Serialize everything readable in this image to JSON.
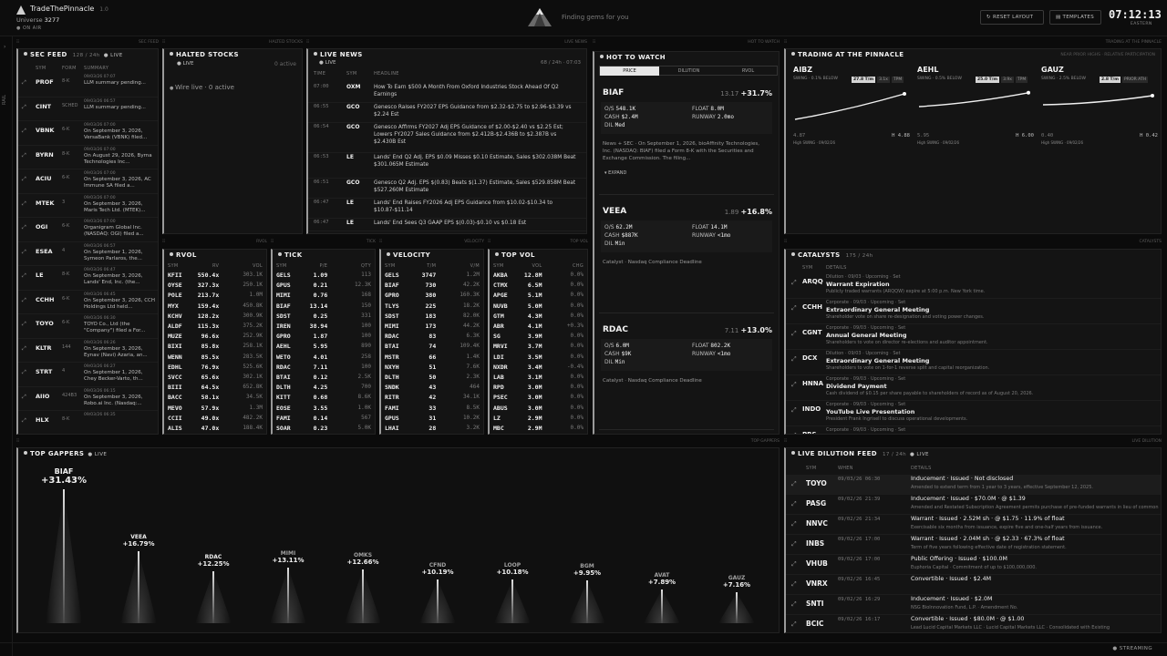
{
  "app": {
    "name": "TradeThePinnacle",
    "version": "1.0",
    "universe_label": "Universe",
    "universe_count": "3277",
    "onair": "ON AIR",
    "tagline": "Finding gems for you",
    "rail": "RAIL"
  },
  "toolbar": {
    "reset_label": "RESET LAYOUT",
    "templates_label": "TEMPLATES",
    "clock": "07:12:13",
    "timezone": "EASTERN"
  },
  "sec_feed": {
    "title": "SEC FEED",
    "count": "128 / 24h",
    "live": "LIVE",
    "tag": "SEC FEED",
    "headers": [
      "SYM",
      "FORM",
      "SUMMARY"
    ],
    "rows": [
      {
        "sym": "PROF",
        "form": "8-K",
        "time": "09/03/26 07:07",
        "summary": "LLM summary pending..."
      },
      {
        "sym": "CINT",
        "form": "SCHED",
        "time": "09/03/26 06:57",
        "summary": "LLM summary pending..."
      },
      {
        "sym": "VBNK",
        "form": "6-K",
        "time": "09/03/26 07:00",
        "summary": "On September 3, 2026, VersaBank (VBNK) filed..."
      },
      {
        "sym": "BYRN",
        "form": "8-K",
        "time": "09/03/26 07:00",
        "summary": "On August 29, 2026, Byrna Technologies Inc..."
      },
      {
        "sym": "ACIU",
        "form": "6-K",
        "time": "09/03/26 07:00",
        "summary": "On September 3, 2026, AC Immune SA filed a..."
      },
      {
        "sym": "MTEK",
        "form": "3",
        "time": "09/03/26 07:00",
        "summary": "On September 3, 2026, Maris Tech Ltd. (MTEK)..."
      },
      {
        "sym": "OGI",
        "form": "6-K",
        "time": "09/03/26 07:00",
        "summary": "Organigram Global Inc. (NASDAQ: OGI) filed a..."
      },
      {
        "sym": "ESEA",
        "form": "4",
        "time": "09/03/26 06:57",
        "summary": "On September 1, 2026, Symeon Parlaros, the..."
      },
      {
        "sym": "LE",
        "form": "8-K",
        "time": "09/03/26 06:47",
        "summary": "On September 3, 2026, Lands' End, Inc. (the..."
      },
      {
        "sym": "CCHH",
        "form": "6-K",
        "time": "09/03/26 06:45",
        "summary": "On September 3, 2026, CCH Holdings Ltd held..."
      },
      {
        "sym": "TOYO",
        "form": "6-K",
        "time": "09/03/26 06:30",
        "summary": "TOYO Co., Ltd (the \"Company\") filed a For..."
      },
      {
        "sym": "KLTR",
        "form": "144",
        "time": "09/03/26 06:26",
        "summary": "On September 3, 2026, Eynav (Navi) Azaria, an..."
      },
      {
        "sym": "STRT",
        "form": "4",
        "time": "09/03/26 06:27",
        "summary": "On September 1, 2026, Chey Becker-Varto, th..."
      },
      {
        "sym": "AIIO",
        "form": "424B3",
        "time": "09/03/26 06:15",
        "summary": "On September 3, 2026, Robo.ai Inc. (Nasdaq:..."
      },
      {
        "sym": "HLX",
        "form": "8-K",
        "time": "09/03/26 06:35",
        "summary": ""
      }
    ]
  },
  "halted": {
    "title": "HALTED STOCKS",
    "live": "LIVE",
    "active": "0 active",
    "tag": "HALTED STOCKS",
    "wire": "Wire live · 0 active"
  },
  "news": {
    "title": "LIVE NEWS",
    "live": "LIVE",
    "count": "68 / 24h",
    "time": "07:03",
    "tag": "LIVE NEWS",
    "headers": [
      "TIME",
      "SYM",
      "HEADLINE"
    ],
    "rows": [
      {
        "time": "07:00",
        "sym": "OXM",
        "text": "How To Earn $500 A Month From Oxford Industries Stock Ahead Of Q2 Earnings"
      },
      {
        "time": "06:55",
        "sym": "GCO",
        "text": "Genesco Raises FY2027 EPS Guidance from $2.32-$2.75 to $2.96-$3.39 vs $2.24 Est"
      },
      {
        "time": "06:54",
        "sym": "GCO",
        "text": "Genesco Affirms FY2027 Adj EPS Guidance of $2.00-$2.40 vs $2.25 Est; Lowers FY2027 Sales Guidance from $2.412B-$2.436B to $2.387B vs $2.430B Est"
      },
      {
        "time": "06:53",
        "sym": "LE",
        "text": "Lands' End Q2 Adj. EPS $0.09 Misses $0.10 Estimate, Sales $302.038M Beat $301.065M Estimate"
      },
      {
        "time": "06:51",
        "sym": "GCO",
        "text": "Genesco Q2 Adj. EPS $(0.83) Beats $(1.37) Estimate, Sales $529.858M Beat $527.260M Estimate"
      },
      {
        "time": "06:47",
        "sym": "LE",
        "text": "Lands' End Raises FY2026 Adj EPS Guidance from $10.02-$10.34 to $10.87-$11.14"
      },
      {
        "time": "06:47",
        "sym": "LE",
        "text": "Lands' End Sees Q3 GAAP EPS $(0.03)-$0.10 vs $0.18 Est"
      }
    ]
  },
  "hot": {
    "title": "HOT TO WATCH",
    "tag": "HOT TO WATCH",
    "tabs": [
      "PRICE",
      "DILUTION",
      "RVOL"
    ],
    "cards": [
      {
        "sym": "BIAF",
        "price": "13.17",
        "chg": "+31.7%",
        "os": "548.1K",
        "cash": "$2.4M",
        "dil": "Med",
        "float": "8.0M",
        "runway": "2.0mo",
        "news": "News + SEC · On September 1, 2026, bioAffinity Technologies, Inc. (NASDAQ: BIAF) filed a Form 8-K with the Securities and Exchange Commission. The filing...",
        "expand": "EXPAND"
      },
      {
        "sym": "VEEA",
        "price": "1.89",
        "chg": "+16.8%",
        "os": "62.2M",
        "cash": "$887K",
        "dil": "Min",
        "float": "14.1M",
        "runway": "<1mo",
        "news": "Catalyst · Nasdaq Compliance Deadline"
      },
      {
        "sym": "RDAC",
        "price": "7.11",
        "chg": "+13.0%",
        "os": "6.0M",
        "cash": "$9K",
        "dil": "Min",
        "float": "802.2K",
        "runway": "<1mo",
        "news": "Catalyst · Nasdaq Compliance Deadline"
      }
    ]
  },
  "pinnacle": {
    "title": "TRADING AT THE PINNACLE",
    "sub": "NEAR PRIOR HIGHS · RELATIVE PARTICIPATION",
    "tag": "TRADING AT THE PINNACLE",
    "items": [
      {
        "sym": "AIBZ",
        "chip1": "27.8 T/m",
        "chip2": "3.1x",
        "chip3": "TPM",
        "note": "SWING · 0.1% BELOW",
        "low": "4.87",
        "high": "H 4.88",
        "foot": "High SWING · 09/02/26",
        "y0": 0.15,
        "y1": 0.85
      },
      {
        "sym": "AEHL",
        "chip1": "25.0 T/m",
        "chip2": "3.9x",
        "chip3": "TPM",
        "note": "SWING · 0.5% BELOW",
        "low": "5.95",
        "high": "H 6.00",
        "foot": "High SWING · 09/02/26",
        "y0": 0.5,
        "y1": 0.88
      },
      {
        "sym": "GAUZ",
        "chip1": "2.8 T/m",
        "chip2": "PRIOR ATH",
        "chip3": "",
        "note": "SWING · 2.5% BELOW",
        "low": "0.40",
        "high": "H 0.42",
        "foot": "High SWING · 09/02/26",
        "y0": 0.55,
        "y1": 0.8
      }
    ]
  },
  "rvol": {
    "title": "RVOL",
    "tag": "RVOL",
    "headers": [
      "SYM",
      "RV",
      "VOL"
    ],
    "rows": [
      [
        "KFII",
        "550.4x",
        "303.1K"
      ],
      [
        "OYSE",
        "327.3x",
        "250.1K"
      ],
      [
        "POLE",
        "213.7x",
        "1.0M"
      ],
      [
        "MYX",
        "159.4x",
        "450.8K"
      ],
      [
        "KCHV",
        "128.2x",
        "300.9K"
      ],
      [
        "ALDF",
        "115.3x",
        "375.2K"
      ],
      [
        "MUZE",
        "96.6x",
        "252.9K"
      ],
      [
        "BIXI",
        "85.8x",
        "258.1K"
      ],
      [
        "WENN",
        "85.5x",
        "283.5K"
      ],
      [
        "EDHL",
        "76.9x",
        "525.6K"
      ],
      [
        "SVCC",
        "65.6x",
        "302.1K"
      ],
      [
        "BIII",
        "64.5x",
        "652.8K"
      ],
      [
        "BACC",
        "58.1x",
        "34.5K"
      ],
      [
        "MEVO",
        "57.9x",
        "1.3M"
      ],
      [
        "CCII",
        "49.0x",
        "482.2K"
      ],
      [
        "ALIS",
        "47.0x",
        "188.4K"
      ]
    ]
  },
  "tick": {
    "title": "TICK",
    "tag": "TICK",
    "headers": [
      "SYM",
      "P/E",
      "QTY"
    ],
    "rows": [
      [
        "GELS",
        "1.09",
        "113"
      ],
      [
        "GPUS",
        "0.21",
        "12.3K"
      ],
      [
        "MIMI",
        "0.76",
        "168"
      ],
      [
        "BIAF",
        "13.14",
        "150"
      ],
      [
        "SDST",
        "0.25",
        "331"
      ],
      [
        "IREN",
        "38.94",
        "100"
      ],
      [
        "GPRO",
        "1.87",
        "100"
      ],
      [
        "AEHL",
        "5.95",
        "890"
      ],
      [
        "WETO",
        "4.01",
        "258"
      ],
      [
        "RDAC",
        "7.11",
        "100"
      ],
      [
        "BTAI",
        "0.12",
        "2.5K"
      ],
      [
        "DLTH",
        "4.25",
        "700"
      ],
      [
        "KITT",
        "0.68",
        "8.6K"
      ],
      [
        "EOSE",
        "3.55",
        "1.0K"
      ],
      [
        "FAMI",
        "0.14",
        "567"
      ],
      [
        "SOAR",
        "0.23",
        "5.0K"
      ]
    ]
  },
  "velocity": {
    "title": "VELOCITY",
    "tag": "VELOCITY",
    "headers": [
      "SYM",
      "T/M",
      "V/M"
    ],
    "rows": [
      [
        "GELS",
        "3747",
        "1.2M"
      ],
      [
        "BIAF",
        "730",
        "42.2K"
      ],
      [
        "GPRO",
        "380",
        "160.3K"
      ],
      [
        "TLYS",
        "225",
        "18.2K"
      ],
      [
        "SDST",
        "183",
        "82.0K"
      ],
      [
        "MIMI",
        "173",
        "44.2K"
      ],
      [
        "RDAC",
        "83",
        "6.3K"
      ],
      [
        "BTAI",
        "74",
        "109.4K"
      ],
      [
        "MSTR",
        "66",
        "1.4K"
      ],
      [
        "NXYH",
        "51",
        "7.6K"
      ],
      [
        "DLTH",
        "50",
        "2.3K"
      ],
      [
        "SNDK",
        "43",
        "464"
      ],
      [
        "RITR",
        "42",
        "34.1K"
      ],
      [
        "FAMI",
        "33",
        "8.5K"
      ],
      [
        "GPUS",
        "31",
        "10.2K"
      ],
      [
        "LHAI",
        "28",
        "3.2K"
      ]
    ]
  },
  "topvol": {
    "title": "TOP VOL",
    "tag": "TOP VOL",
    "headers": [
      "SYM",
      "VOL",
      "CHG"
    ],
    "rows": [
      [
        "AKBA",
        "12.8M",
        "0.0%"
      ],
      [
        "CTMX",
        "6.5M",
        "0.0%"
      ],
      [
        "APGE",
        "5.1M",
        "0.0%"
      ],
      [
        "NUVB",
        "5.0M",
        "0.0%"
      ],
      [
        "GTM",
        "4.3M",
        "0.0%"
      ],
      [
        "ABR",
        "4.1M",
        "+0.3%"
      ],
      [
        "SG",
        "3.9M",
        "0.0%"
      ],
      [
        "MRVI",
        "3.7M",
        "0.0%"
      ],
      [
        "LDI",
        "3.5M",
        "0.0%"
      ],
      [
        "NXDR",
        "3.4M",
        "-0.4%"
      ],
      [
        "LAB",
        "3.1M",
        "0.0%"
      ],
      [
        "RPD",
        "3.0M",
        "0.0%"
      ],
      [
        "PSEC",
        "3.0M",
        "0.0%"
      ],
      [
        "ABUS",
        "3.0M",
        "0.0%"
      ],
      [
        "LZ",
        "2.9M",
        "0.0%"
      ],
      [
        "MBC",
        "2.9M",
        "0.0%"
      ]
    ]
  },
  "catalysts": {
    "title": "CATALYSTS",
    "count": "175 / 24h",
    "tag": "CATALYSTS",
    "headers": [
      "SYM",
      "DETAILS"
    ],
    "rows": [
      {
        "sym": "ARQQ",
        "meta": "Dilution · 09/03 · Upcoming · Set",
        "head": "Warrant Expiration",
        "desc": "Publicly traded warrants (ARQQW) expire at 5:00 p.m. New York time."
      },
      {
        "sym": "CCHH",
        "meta": "Corporate · 09/03 · Upcoming · Set",
        "head": "Extraordinary General Meeting",
        "desc": "Shareholder vote on share re-designation and voting power changes."
      },
      {
        "sym": "CGNT",
        "meta": "Corporate · 09/03 · Upcoming · Set",
        "head": "Annual General Meeting",
        "desc": "Shareholders to vote on director re-elections and auditor appointment."
      },
      {
        "sym": "DCX",
        "meta": "Dilution · 09/03 · Upcoming · Set",
        "head": "Extraordinary General Meeting",
        "desc": "Shareholders to vote on 1-for-1 reverse split and capital reorganization."
      },
      {
        "sym": "HNNA",
        "meta": "Corporate · 09/03 · Upcoming · Set",
        "head": "Dividend Payment",
        "desc": "Cash dividend of $0.15 per share payable to shareholders of record as of August 20, 2026."
      },
      {
        "sym": "INDO",
        "meta": "Corporate · 09/03 · Upcoming · Set",
        "head": "YouTube Live Presentation",
        "desc": "President Frank Ingrisell to discuss operational developments."
      },
      {
        "sym": "PRS",
        "meta": "Corporate · 09/03 · Upcoming · Set",
        "head": "",
        "desc": ""
      }
    ]
  },
  "gappers": {
    "title": "TOP GAPPERS",
    "live": "LIVE",
    "tag": "TOP GAPPERS",
    "items": [
      {
        "sym": "BIAF",
        "pct": "+31.43%",
        "value": 31.43
      },
      {
        "sym": "VEEA",
        "pct": "+16.79%",
        "value": 16.79
      },
      {
        "sym": "RDAC",
        "pct": "+12.25%",
        "value": 12.25
      },
      {
        "sym": "MIMI",
        "pct": "+13.11%",
        "value": 13.11
      },
      {
        "sym": "OMKS",
        "pct": "+12.66%",
        "value": 12.66
      },
      {
        "sym": "CFND",
        "pct": "+10.19%",
        "value": 10.19
      },
      {
        "sym": "LOOP",
        "pct": "+10.18%",
        "value": 10.18
      },
      {
        "sym": "BGM",
        "pct": "+9.95%",
        "value": 9.95
      },
      {
        "sym": "AVAT",
        "pct": "+7.89%",
        "value": 7.89
      },
      {
        "sym": "GAUZ",
        "pct": "+7.16%",
        "value": 7.16
      }
    ]
  },
  "dilution": {
    "title": "LIVE DILUTION FEED",
    "count": "17 / 24h",
    "live": "LIVE",
    "tag": "LIVE DILUTION",
    "headers": [
      "SYM",
      "WHEN",
      "DETAILS"
    ],
    "rows": [
      {
        "sym": "TOYO",
        "when": "09/03/26 06:30",
        "head": "Inducement · Issued · Not disclosed",
        "desc": "Amended to extend term from 1 year to 3 years, effective September 12, 2025."
      },
      {
        "sym": "PASG",
        "when": "09/02/26 21:39",
        "head": "Inducement · Issued · $70.0M · @ $1.39",
        "desc": "Amended and Restated Subscription Agreement permits purchase of pre-funded warrants in lieu of common stock at $1."
      },
      {
        "sym": "NNVC",
        "when": "09/02/26 21:34",
        "head": "Warrant · Issued · 2.52M sh · @ $1.75 · 11.9% of float",
        "desc": "Exercisable six months from issuance, expire five and one-half years from issuance."
      },
      {
        "sym": "INBS",
        "when": "09/02/26 17:00",
        "head": "Warrant · Issued · 2.04M sh · @ $2.33 · 67.3% of float",
        "desc": "Term of five years following effective date of registration statement."
      },
      {
        "sym": "VHUB",
        "when": "09/02/26 17:00",
        "head": "Public Offering · Issued · $100.0M",
        "desc": "Euphoria Capital · Commitment of up to $100,000,000."
      },
      {
        "sym": "VNRX",
        "when": "09/02/26 16:45",
        "head": "Convertible · Issued · $2.4M",
        "desc": ""
      },
      {
        "sym": "SNTI",
        "when": "09/02/26 16:29",
        "head": "Inducement · Issued · $2.0M",
        "desc": "NSG BioInnovation Fund, L.P. · Amendment No."
      },
      {
        "sym": "BCIC",
        "when": "09/02/26 16:17",
        "head": "Convertible · Issued · $80.0M · @ $1.00",
        "desc": "Lead Lucid Capital Markets LLC · Lucid Capital Markets LLC · Consolidated with Existing"
      }
    ]
  },
  "footer": {
    "streaming": "STREAMING"
  }
}
